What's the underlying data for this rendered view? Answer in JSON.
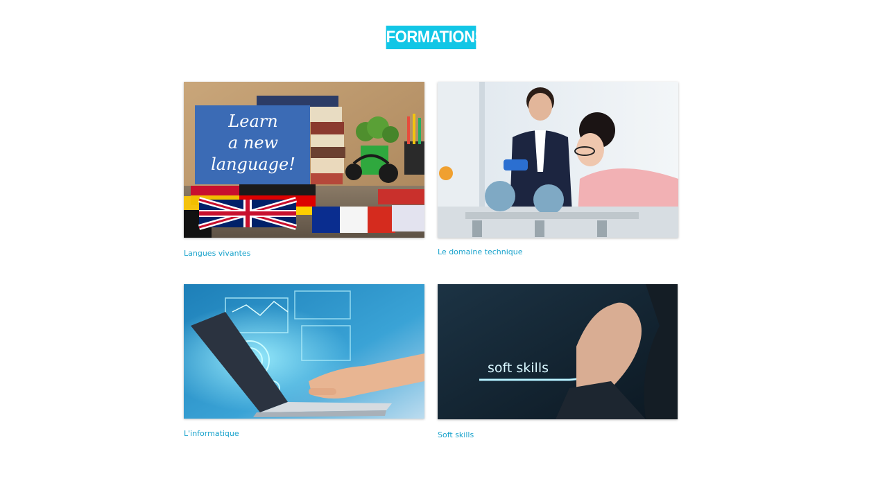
{
  "header": {
    "title": "FORMATIONS",
    "accent_color": "#12c6e6"
  },
  "cards": [
    {
      "caption": "Langues vivantes",
      "image_text": [
        "Learn",
        "a new",
        "language!"
      ]
    },
    {
      "caption": "Le domaine technique"
    },
    {
      "caption": "L'informatique"
    },
    {
      "caption": "Soft skills",
      "image_text": "soft skills"
    }
  ],
  "caption_color": "#1aa3cc"
}
